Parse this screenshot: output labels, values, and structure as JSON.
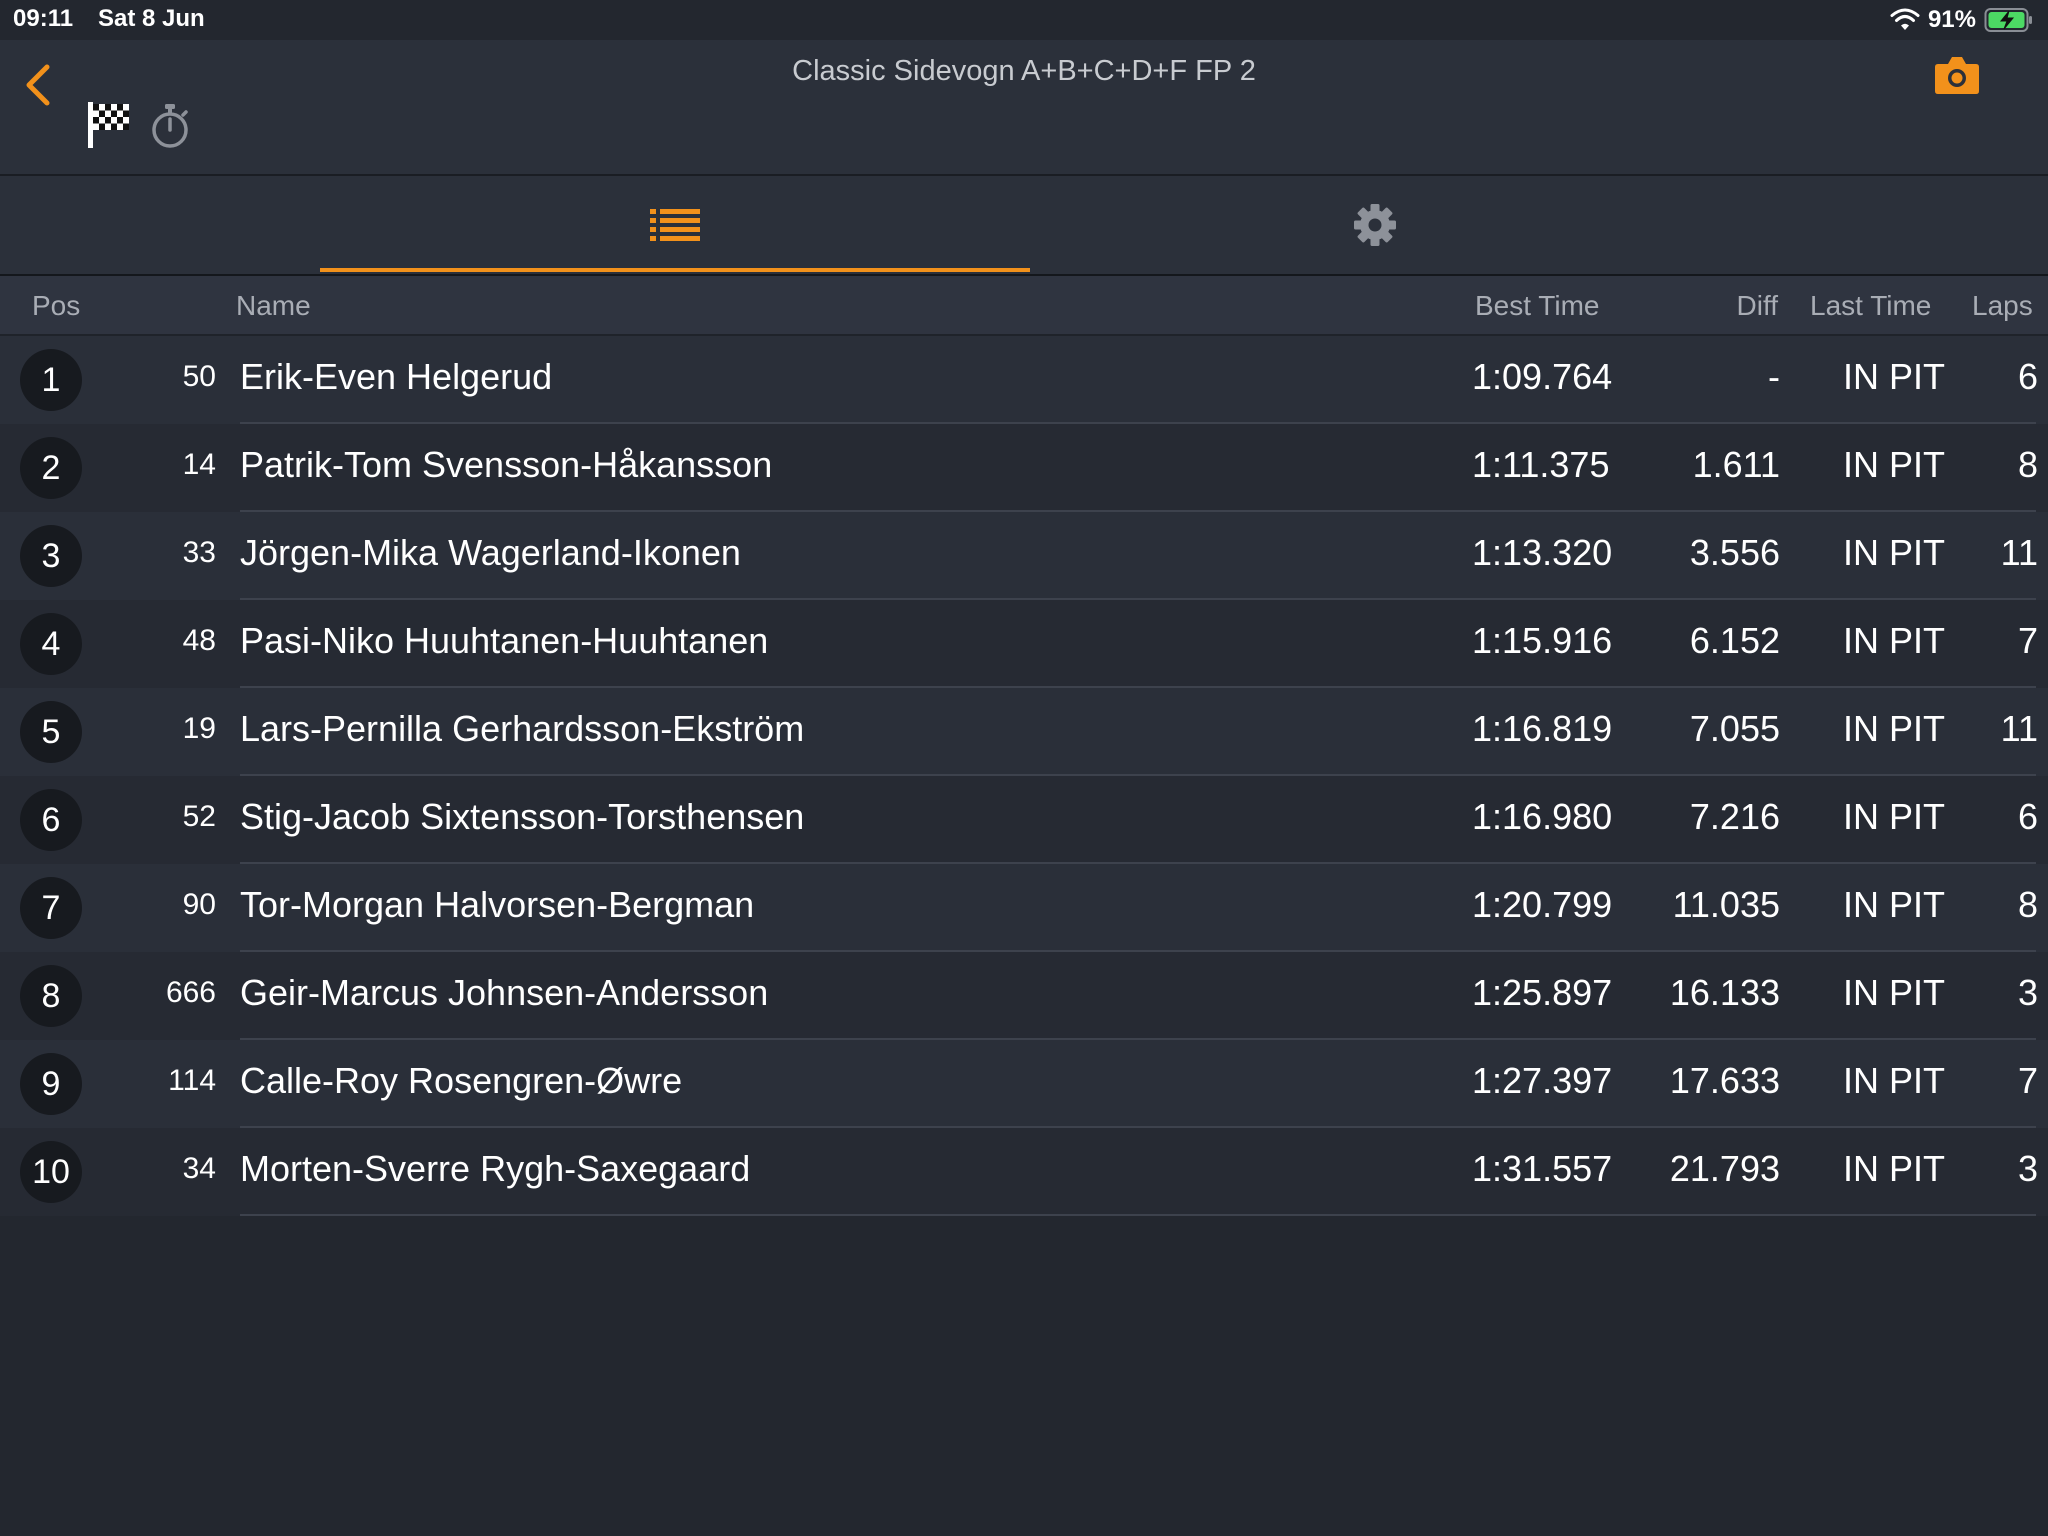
{
  "status_bar": {
    "time": "09:11",
    "date": "Sat 8 Jun",
    "battery_pct": "91%"
  },
  "header": {
    "title": "Classic Sidevogn A+B+C+D+F FP 2"
  },
  "colors": {
    "accent": "#f2911b",
    "background": "#23272f",
    "header_bg": "#2b303a"
  },
  "icons": {
    "back": "chevron-left-icon",
    "flag": "checkered-flag-icon",
    "timer": "stopwatch-icon",
    "camera": "camera-icon",
    "list": "list-icon",
    "settings": "gear-icon"
  },
  "tabs": {
    "active": "list"
  },
  "columns": {
    "pos": "Pos",
    "name": "Name",
    "best": "Best Time",
    "diff": "Diff",
    "last": "Last Time",
    "laps": "Laps"
  },
  "rows": [
    {
      "pos": "1",
      "num": "50",
      "name": "Erik-Even Helgerud",
      "best": "1:09.764",
      "diff": "-",
      "last": "IN PIT",
      "laps": "6"
    },
    {
      "pos": "2",
      "num": "14",
      "name": "Patrik-Tom Svensson-Håkansson",
      "best": "1:11.375",
      "diff": "1.611",
      "last": "IN PIT",
      "laps": "8"
    },
    {
      "pos": "3",
      "num": "33",
      "name": "Jörgen-Mika Wagerland-Ikonen",
      "best": "1:13.320",
      "diff": "3.556",
      "last": "IN PIT",
      "laps": "11"
    },
    {
      "pos": "4",
      "num": "48",
      "name": "Pasi-Niko Huuhtanen-Huuhtanen",
      "best": "1:15.916",
      "diff": "6.152",
      "last": "IN PIT",
      "laps": "7"
    },
    {
      "pos": "5",
      "num": "19",
      "name": "Lars-Pernilla Gerhardsson-Ekström",
      "best": "1:16.819",
      "diff": "7.055",
      "last": "IN PIT",
      "laps": "11"
    },
    {
      "pos": "6",
      "num": "52",
      "name": "Stig-Jacob Sixtensson-Torsthensen",
      "best": "1:16.980",
      "diff": "7.216",
      "last": "IN PIT",
      "laps": "6"
    },
    {
      "pos": "7",
      "num": "90",
      "name": "Tor-Morgan Halvorsen-Bergman",
      "best": "1:20.799",
      "diff": "11.035",
      "last": "IN PIT",
      "laps": "8"
    },
    {
      "pos": "8",
      "num": "666",
      "name": "Geir-Marcus Johnsen-Andersson",
      "best": "1:25.897",
      "diff": "16.133",
      "last": "IN PIT",
      "laps": "3"
    },
    {
      "pos": "9",
      "num": "114",
      "name": "Calle-Roy Rosengren-Øwre",
      "best": "1:27.397",
      "diff": "17.633",
      "last": "IN PIT",
      "laps": "7"
    },
    {
      "pos": "10",
      "num": "34",
      "name": "Morten-Sverre Rygh-Saxegaard",
      "best": "1:31.557",
      "diff": "21.793",
      "last": "IN PIT",
      "laps": "3"
    }
  ]
}
